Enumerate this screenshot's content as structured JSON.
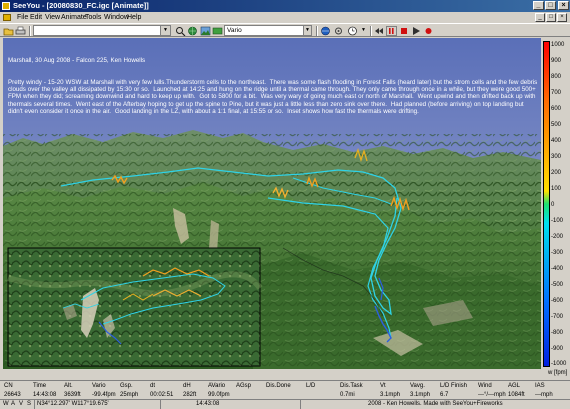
{
  "title_bar": {
    "title": "SeeYou - [20080830_FC.igc [Animate]]",
    "buttons": [
      "_",
      "□",
      "×"
    ]
  },
  "menu": {
    "items": [
      "File",
      "Edit",
      "View",
      "Animate",
      "Tools",
      "Window",
      "Help"
    ],
    "mdi_buttons": [
      "_",
      "□",
      "×"
    ]
  },
  "toolbar": {
    "time_value": "",
    "mode_value": "Vario",
    "mode_options": [
      "Vario"
    ]
  },
  "flight_notes": {
    "heading": "Marshall, 30 Aug 2008 - Falcon 225, Ken Howells",
    "body": "Pretty windy - 15-20 WSW at Marshall with very few lulls.Thunderstorm cells to the northeast.  There was some flash flooding in Forest Falls (heard later) but the strom cells and the few debris clouds over the valley all dissipated by 15:30 or so.  Launched at 14:25 and hung on the ridge until a thermal came through. They only came through once in a while, but they were good 500+ FPM when they did; screaming downwind and hard to keep up with.  Got to 5800 for a bit.  Was very wary of going much east or north of Marshall.  Went upwind and then drifted back up with thermals several times.  Went east of the Afterbay hoping to get up the spine to Pine, but it was just a little less than zero sink over there.  Had planned (before arriving) on top landing but didn't even consider it once in the air.  Good landing in the LZ, with about a 1:1 final, at 15:55 or so.  Inset shows how fast the thermals were drifting."
  },
  "vario_scale": {
    "labels": [
      "1000",
      "900",
      "800",
      "700",
      "600",
      "500",
      "400",
      "300",
      "200",
      "100",
      "0",
      "-100",
      "-200",
      "-300",
      "-400",
      "-500",
      "-600",
      "-700",
      "-800",
      "-900",
      "-1000"
    ],
    "unit": "w [fpm]"
  },
  "data_table": {
    "headers": [
      "CN",
      "Time",
      "Alt.",
      "Vario",
      "Gsp.",
      "dt",
      "dH",
      "AVario",
      "AGsp",
      "Dis.Done",
      "L/D",
      "Dis.Task",
      "Vt",
      "Vavg.",
      "L/D Finish",
      "Wind",
      "AGL",
      "IAS"
    ],
    "values": [
      "26643",
      "14:43:08",
      "3639ft",
      "-99.4fpm",
      "25mph",
      "00:02:51",
      "282ft",
      "99.0fpm",
      "",
      "",
      "",
      "0.7mi",
      "3.1mph",
      "3.1mph",
      "6.7",
      "---°/---mph",
      "1084ft",
      "---mph"
    ]
  },
  "status_bar": {
    "buttons": [
      "W",
      "A",
      "V",
      "S"
    ],
    "coordinates": "N34°12.297' W117°19.675'",
    "time": "14:43:08",
    "credit": "2008 - Ken Howells. Made with SeeYou+Fireworks"
  },
  "colors": {
    "title_gradient_start": "#0a246a",
    "title_gradient_end": "#3a6ea5",
    "window_face": "#d4d0c8",
    "sky": "#8a97c8",
    "terrain": "#3f7a2e",
    "track_cyan": "#2fd2e6",
    "track_orange": "#f0a020",
    "track_blue": "#2b5fe0"
  },
  "icons": [
    "app-icon",
    "open-icon",
    "print-icon",
    "zoom-icon",
    "globe-icon",
    "photo-icon",
    "settings-icon",
    "clock-icon",
    "rewind-icon",
    "play-icon",
    "pause-icon",
    "stop-icon",
    "record-icon"
  ]
}
